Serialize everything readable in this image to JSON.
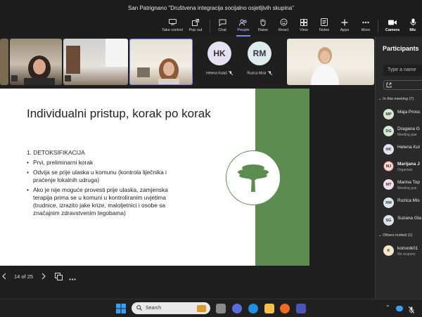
{
  "window": {
    "title": "San Patrignano \"Društvena integracija socijalno osjetljivih skupina\""
  },
  "toolbar": {
    "take_control": "Take control",
    "pop_out": "Pop out",
    "chat": "Chat",
    "people": "People",
    "raise": "Raise",
    "react": "React",
    "view": "View",
    "notes": "Notes",
    "apps": "Apps",
    "more": "More",
    "camera": "Camera",
    "mic": "Mic"
  },
  "video_tiles": [
    {
      "initials": "HK",
      "name": "Helena Kulaš",
      "color": "#e6e0f3"
    },
    {
      "initials": "RM",
      "name": "Ruzica Misir",
      "color": "#dcecee"
    }
  ],
  "slide": {
    "title": "Individualni pristup, korak po korak",
    "heading": "1. DETOKSIFIKACIJA",
    "bullets": [
      "Prvi, preliminarni korak",
      "Odvija se prije ulaska u komunu (kontrola liječnika i praćenje lokalnih udruga)",
      "Ako je nije moguće provesti prije ulaska, zamjenska terapija prima se u komuni u kontroliranim uvjetima (trudnice, izrazito jake krize, maloljetnici i osobe sa značajnim zdravstvenim tegobama)"
    ],
    "band_color": "#5d8c51"
  },
  "slide_nav": {
    "page": "14 of 25"
  },
  "participants": {
    "title": "Participants",
    "search_placeholder": "Type a name",
    "in_meeting_header": "In this meeting (7)",
    "people": [
      {
        "initials": "MP",
        "name": "Maja Prosc",
        "sub": "",
        "color": "#d8e8d0"
      },
      {
        "initials": "DG",
        "name": "Dragana G",
        "sub": "Meeting gue",
        "color": "#d6ead8"
      },
      {
        "initials": "HK",
        "name": "Helena Kul",
        "sub": "",
        "color": "#e6e0f3"
      },
      {
        "initials": "MJ",
        "name": "Marijana J",
        "sub": "Organiser",
        "color": "#f3dede"
      },
      {
        "initials": "MT",
        "name": "Marina Top",
        "sub": "Meeting gue",
        "color": "#f3dfe8"
      },
      {
        "initials": "RM",
        "name": "Ruzica Mis",
        "sub": "",
        "color": "#dcecee"
      },
      {
        "initials": "SG",
        "name": "Suzana Gla",
        "sub": "",
        "color": "#dde3ee"
      }
    ],
    "others_header": "Others invited (1)",
    "others": [
      {
        "initials": "K",
        "name": "korisnik01",
        "sub": "No respons",
        "color": "#f6e7c8"
      }
    ]
  },
  "taskbar": {
    "search": "Search"
  }
}
